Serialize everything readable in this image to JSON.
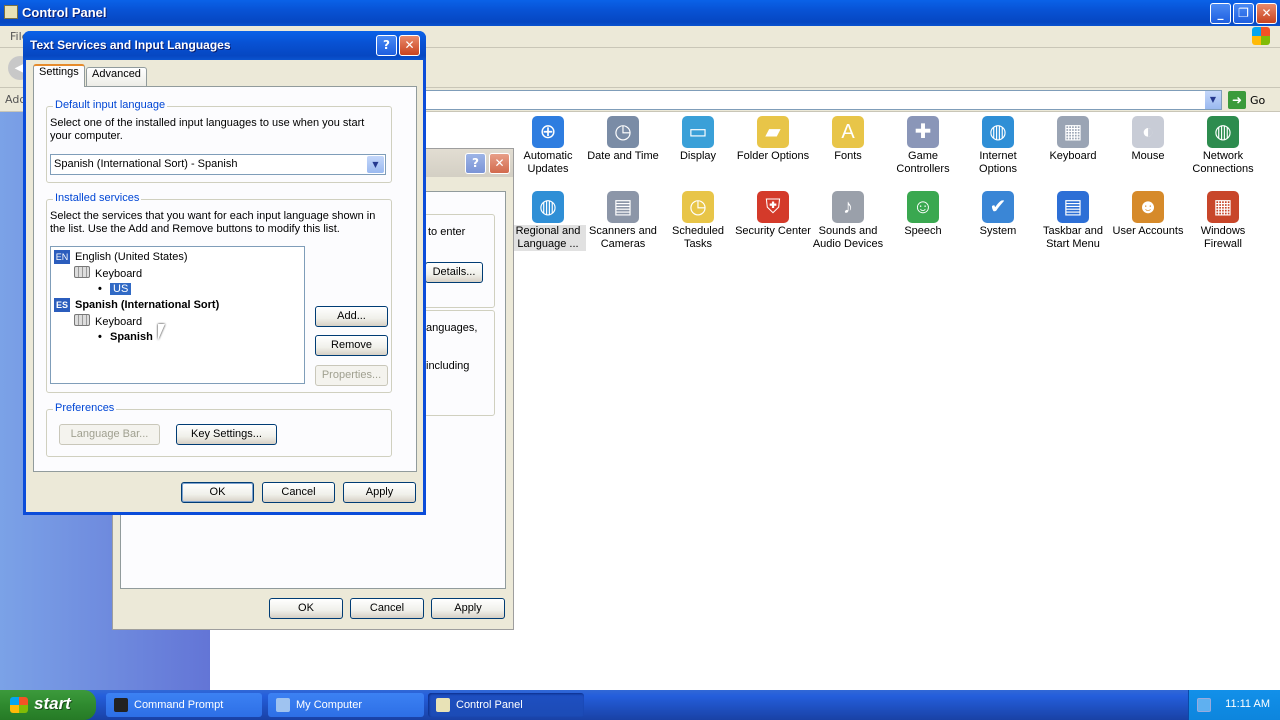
{
  "control_panel": {
    "title": "Control Panel",
    "menu_first": "File",
    "address_label": "Address",
    "go_label": "Go",
    "icons": [
      {
        "label": "Automatic Updates",
        "icon": "shield-update-icon",
        "color": "#2e7de0",
        "glyph": "⊕"
      },
      {
        "label": "Date and Time",
        "icon": "clock-icon",
        "color": "#7a8ca6",
        "glyph": "◷"
      },
      {
        "label": "Display",
        "icon": "display-icon",
        "color": "#3aa0d8",
        "glyph": "▭"
      },
      {
        "label": "Folder Options",
        "icon": "folder-icon",
        "color": "#e8c548",
        "glyph": "▰"
      },
      {
        "label": "Fonts",
        "icon": "fonts-folder-icon",
        "color": "#e8c548",
        "glyph": "A"
      },
      {
        "label": "Game Controllers",
        "icon": "gamepad-icon",
        "color": "#8a96b8",
        "glyph": "✚"
      },
      {
        "label": "Internet Options",
        "icon": "globe-icon",
        "color": "#2f8fd6",
        "glyph": "◍"
      },
      {
        "label": "Keyboard",
        "icon": "keyboard-icon",
        "color": "#9aa4b4",
        "glyph": "▦"
      },
      {
        "label": "Mouse",
        "icon": "mouse-icon",
        "color": "#c8ccd6",
        "glyph": "◐"
      },
      {
        "label": "Network Connections",
        "icon": "network-globe-icon",
        "color": "#2d8c4e",
        "glyph": "◍"
      },
      {
        "label": "Regional and Language ...",
        "icon": "regional-globe-icon",
        "color": "#2f8fd6",
        "glyph": "◍"
      },
      {
        "label": "Scanners and Cameras",
        "icon": "scanner-icon",
        "color": "#8c96a8",
        "glyph": "▤"
      },
      {
        "label": "Scheduled Tasks",
        "icon": "scheduled-tasks-icon",
        "color": "#e8c548",
        "glyph": "◷"
      },
      {
        "label": "Security Center",
        "icon": "security-shield-icon",
        "color": "#d43a2a",
        "glyph": "⛨"
      },
      {
        "label": "Sounds and Audio Devices",
        "icon": "speaker-icon",
        "color": "#9aa0aa",
        "glyph": "♪"
      },
      {
        "label": "Speech",
        "icon": "speech-icon",
        "color": "#3aa850",
        "glyph": "☺"
      },
      {
        "label": "System",
        "icon": "system-icon",
        "color": "#3a86d6",
        "glyph": "✔"
      },
      {
        "label": "Taskbar and Start Menu",
        "icon": "taskbar-icon",
        "color": "#2d6fd6",
        "glyph": "▤"
      },
      {
        "label": "User Accounts",
        "icon": "users-icon",
        "color": "#d68a2a",
        "glyph": "☻"
      },
      {
        "label": "Windows Firewall",
        "icon": "firewall-icon",
        "color": "#c8462a",
        "glyph": "▦"
      }
    ]
  },
  "regional_dialog": {
    "text_to_enter": "to enter",
    "details_button": "Details...",
    "text_languages": "anguages,",
    "text_including": "including",
    "ok": "OK",
    "cancel": "Cancel",
    "apply": "Apply"
  },
  "text_services_dialog": {
    "title": "Text Services and Input Languages",
    "help_glyph": "?",
    "close_glyph": "✕",
    "tabs": [
      "Settings",
      "Advanced"
    ],
    "default_group": {
      "title": "Default input language",
      "description": "Select one of the installed input languages to use when you start your computer.",
      "selected": "Spanish (International Sort) - Spanish"
    },
    "installed_group": {
      "title": "Installed services",
      "description": "Select the services that you want for each input language shown in the list. Use the Add and Remove buttons to modify this list.",
      "tree": [
        {
          "badge": "EN",
          "label": "English (United States)"
        },
        {
          "label": "Keyboard"
        },
        {
          "label": "US"
        },
        {
          "badge": "ES",
          "label": "Spanish (International Sort)"
        },
        {
          "label": "Keyboard"
        },
        {
          "label": "Spanish"
        }
      ],
      "add": "Add...",
      "remove": "Remove",
      "properties": "Properties..."
    },
    "preferences_group": {
      "title": "Preferences",
      "language_bar": "Language Bar...",
      "key_settings": "Key Settings..."
    },
    "ok": "OK",
    "cancel": "Cancel",
    "apply": "Apply"
  },
  "taskbar": {
    "start": "start",
    "tasks": [
      {
        "label": "Command Prompt",
        "icon": "command-prompt-icon",
        "color": "#222222"
      },
      {
        "label": "My Computer",
        "icon": "my-computer-icon",
        "color": "#9fc3f0"
      },
      {
        "label": "Control Panel",
        "icon": "control-panel-icon",
        "color": "#e8e2b6"
      }
    ],
    "clock": "11:11 AM"
  }
}
